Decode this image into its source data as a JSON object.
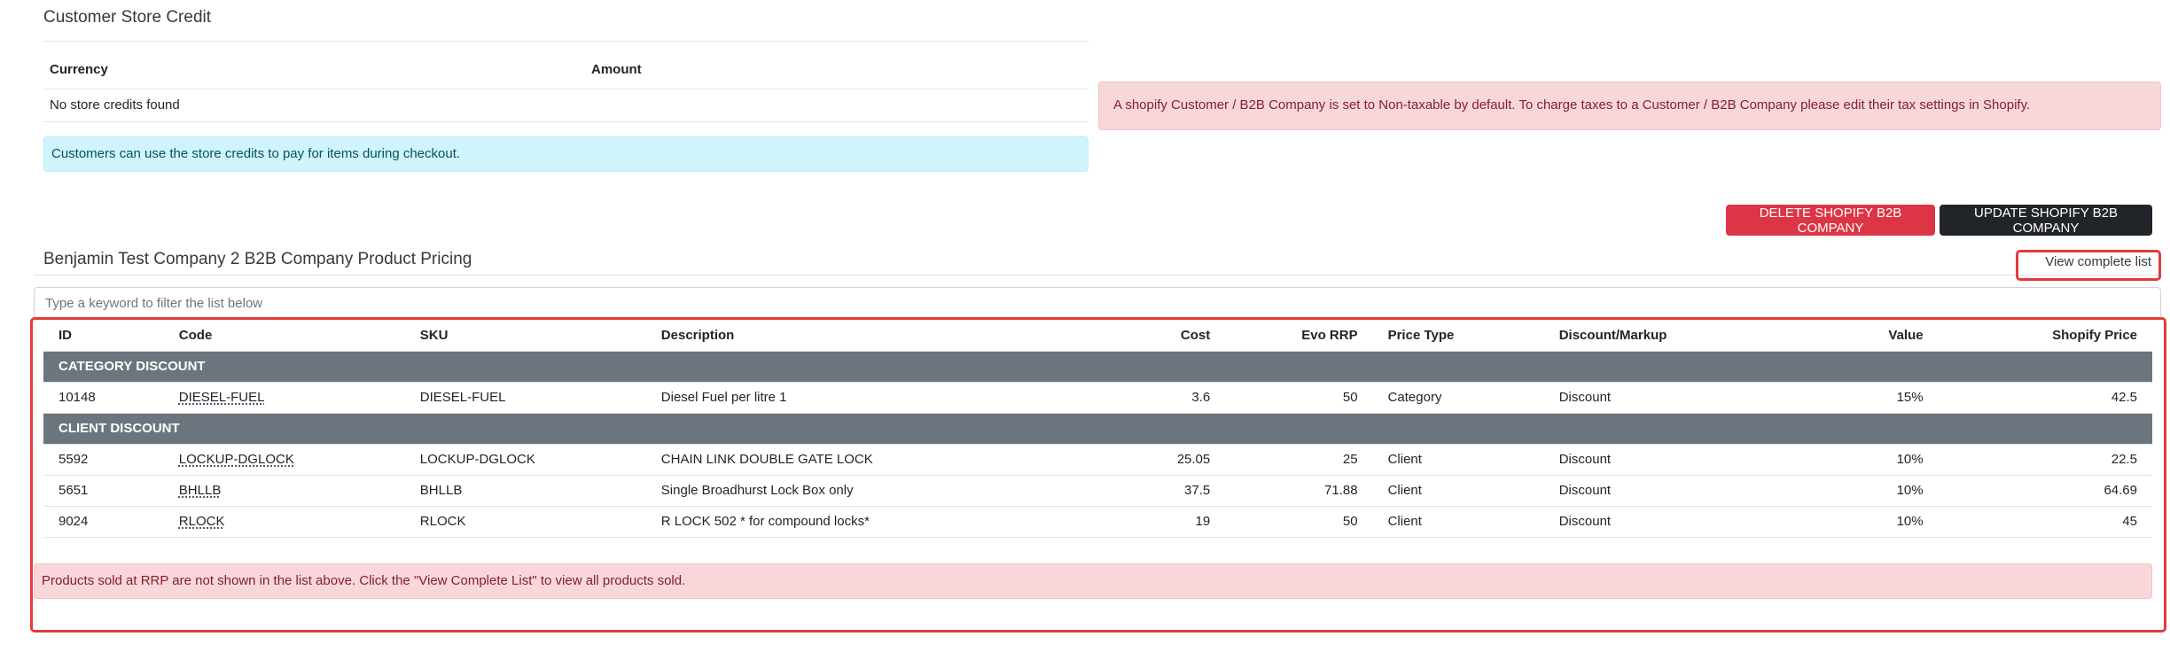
{
  "store_credit": {
    "title": "Customer Store Credit",
    "col_currency": "Currency",
    "col_amount": "Amount",
    "empty_text": "No store credits found",
    "info": "Customers can use the store credits to pay for items during checkout."
  },
  "tax_alert": "A shopify Customer / B2B Company is set to Non-taxable by default.  To charge taxes to a Customer / B2B Company please edit their tax settings in Shopify.",
  "buttons": {
    "delete": "DELETE SHOPIFY B2B COMPANY",
    "update": "UPDATE SHOPIFY B2B COMPANY"
  },
  "colors": {
    "danger": "#dc3545",
    "dark": "#212529",
    "group_header": "#6c757d",
    "alert_bg": "#f8d7da",
    "info_bg": "#cff4fc",
    "highlight_border": "#e03c3c"
  },
  "pricing": {
    "title": "Benjamin Test Company 2 B2B Company Product Pricing",
    "view_complete": "View complete list",
    "filter_placeholder": "Type a keyword to filter the list below",
    "columns": [
      "ID",
      "Code",
      "SKU",
      "Description",
      "Cost",
      "Evo RRP",
      "Price Type",
      "Discount/Markup",
      "Value",
      "Shopify Price"
    ],
    "groups": [
      {
        "label": "CATEGORY DISCOUNT",
        "rows": [
          [
            "10148",
            "DIESEL-FUEL",
            "DIESEL-FUEL",
            "Diesel Fuel per litre 1",
            "3.6",
            "50",
            "Category",
            "Discount",
            "15%",
            "42.5"
          ]
        ]
      },
      {
        "label": "CLIENT DISCOUNT",
        "rows": [
          [
            "5592",
            "LOCKUP-DGLOCK",
            "LOCKUP-DGLOCK",
            "CHAIN LINK DOUBLE GATE LOCK",
            "25.05",
            "25",
            "Client",
            "Discount",
            "10%",
            "22.5"
          ],
          [
            "5651",
            "BHLLB",
            "BHLLB",
            "Single Broadhurst Lock Box only",
            "37.5",
            "71.88",
            "Client",
            "Discount",
            "10%",
            "64.69"
          ],
          [
            "9024",
            "RLOCK",
            "RLOCK",
            "R LOCK 502 * for compound locks*",
            "19",
            "50",
            "Client",
            "Discount",
            "10%",
            "45"
          ]
        ]
      }
    ],
    "rrp_notice": "Products sold at RRP are not shown in the list above.  Click the \"View Complete List\" to view all products sold."
  }
}
